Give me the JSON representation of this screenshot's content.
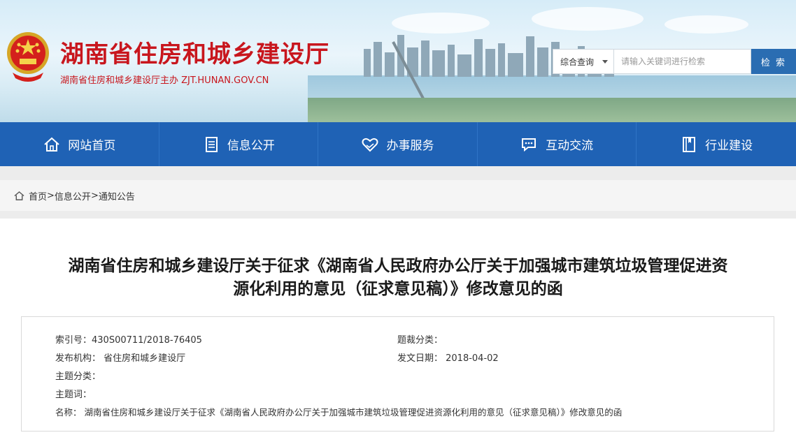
{
  "header": {
    "title": "湖南省住房和城乡建设厅",
    "subtitle": "湖南省住房和城乡建设厅主办  ZJT.HUNAN.GOV.CN",
    "emblem_icon": "national-emblem-icon"
  },
  "search": {
    "scope_selected": "综合查询",
    "placeholder": "请输入关键词进行检索",
    "button_label": "检 索"
  },
  "nav": {
    "items": [
      {
        "label": "网站首页",
        "icon": "home-icon"
      },
      {
        "label": "信息公开",
        "icon": "document-icon"
      },
      {
        "label": "办事服务",
        "icon": "heart-hands-icon"
      },
      {
        "label": "互动交流",
        "icon": "chat-icon"
      },
      {
        "label": "行业建设",
        "icon": "book-icon"
      }
    ]
  },
  "breadcrumb": {
    "home": "首页",
    "sep": ">",
    "level1": "信息公开",
    "level2": "通知公告"
  },
  "article": {
    "title_line1": "湖南省住房和城乡建设厅关于征求《湖南省人民政府办公厅关于加强城市建筑垃圾管理促进资",
    "title_line2": "源化利用的意见（征求意见稿）》修改意见的函"
  },
  "meta": {
    "index_no": "索引号：430S00711/2018-76405",
    "topic_class": "题裁分类：",
    "publisher": "发布机构： 省住房和城乡建设厅",
    "publish_date": "发文日期： 2018-04-02",
    "subject_class": "主题分类：",
    "subject_words": "主题词：",
    "name": "名称： 湖南省住房和城乡建设厅关于征求《湖南省人民政府办公厅关于加强城市建筑垃圾管理促进资源化利用的意见（征求意见稿）》修改意见的函"
  },
  "colors": {
    "brand_red": "#c8161d",
    "nav_blue": "#1f62b5",
    "search_btn": "#2a6db2"
  }
}
